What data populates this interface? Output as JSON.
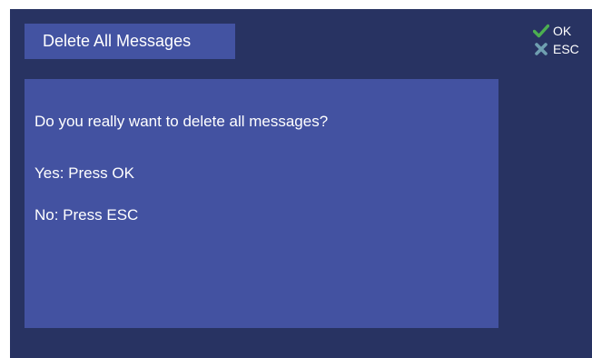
{
  "dialog": {
    "title": "Delete All Messages",
    "question": "Do you really want to delete all messages?",
    "yes_hint": "Yes: Press OK",
    "no_hint": "No: Press ESC"
  },
  "keys": {
    "ok_label": "OK",
    "ok_icon": "checkmark-icon",
    "esc_label": "ESC",
    "esc_icon": "cross-icon"
  },
  "colors": {
    "background": "#283362",
    "panel": "#4352a1",
    "ok_green": "#4caf50",
    "esc_teal": "#6f9fb0"
  }
}
